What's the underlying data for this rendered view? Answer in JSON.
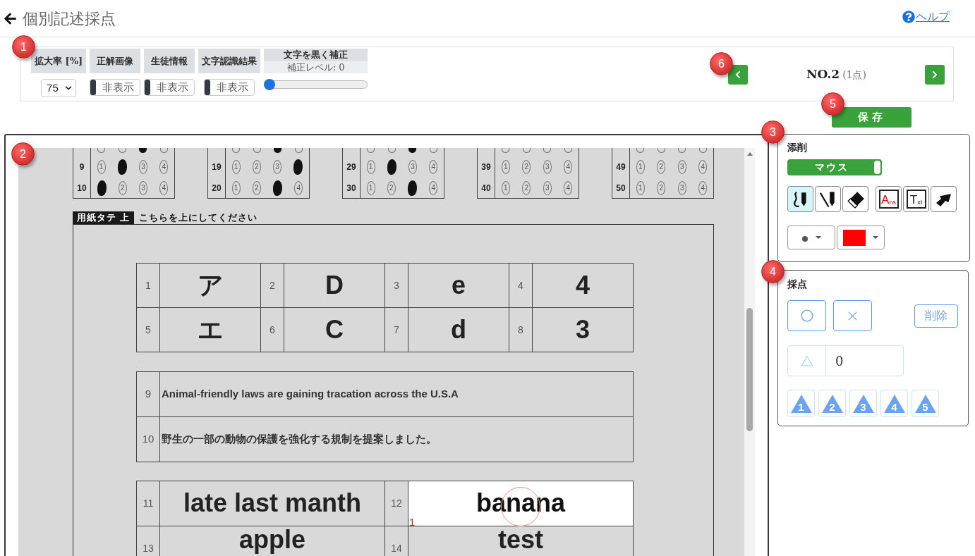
{
  "header": {
    "title": "個別記述採点",
    "help_link": "ヘルプ"
  },
  "toolbar": {
    "controls": [
      {
        "kind": "select",
        "label": "拡大率 [%]",
        "value": "75"
      },
      {
        "kind": "toggle",
        "label": "正解画像",
        "value": "非表示",
        "on": false
      },
      {
        "kind": "toggle",
        "label": "生徒情報",
        "value": "非表示",
        "on": false
      },
      {
        "kind": "toggle",
        "label": "文字認識結果",
        "value": "非表示",
        "on": false
      },
      {
        "kind": "slider",
        "label": "文字を黒く補正",
        "reading": "補正レベル: 0",
        "level": 0
      }
    ],
    "navigation": {
      "number": "NO.2",
      "points": "(1点)"
    }
  },
  "save_button": "保存",
  "answer_sheet": {
    "bubble_blocks": [
      {
        "rows": [
          {
            "bubbles": [
              {
                "filled": false
              },
              {
                "filled": false
              },
              {
                "filled": true
              },
              {
                "filled": false
              }
            ]
          },
          {
            "number": "9",
            "bubbles": [
              {
                "label": "1",
                "filled": false
              },
              {
                "filled": true
              },
              {
                "label": "3",
                "filled": false
              },
              {
                "label": "4",
                "filled": false
              }
            ]
          },
          {
            "number": "10",
            "bubbles": [
              {
                "filled": true
              },
              {
                "label": "2",
                "filled": false
              },
              {
                "label": "3",
                "filled": false
              },
              {
                "label": "4",
                "filled": false
              }
            ]
          }
        ]
      },
      {
        "rows": [
          {
            "bubbles": [
              {
                "filled": false
              },
              {
                "filled": false
              },
              {
                "filled": true
              },
              {
                "filled": false
              }
            ]
          },
          {
            "number": "19",
            "bubbles": [
              {
                "label": "1",
                "filled": false
              },
              {
                "label": "2",
                "filled": false
              },
              {
                "label": "3",
                "filled": false
              },
              {
                "filled": true
              }
            ]
          },
          {
            "number": "20",
            "bubbles": [
              {
                "label": "1",
                "filled": false
              },
              {
                "label": "2",
                "filled": false
              },
              {
                "filled": true
              },
              {
                "label": "4",
                "filled": false
              }
            ]
          }
        ]
      },
      {
        "rows": [
          {
            "bubbles": [
              {
                "filled": false
              },
              {
                "filled": false
              },
              {
                "filled": true
              },
              {
                "filled": false
              }
            ]
          },
          {
            "number": "29",
            "bubbles": [
              {
                "label": "1",
                "filled": false
              },
              {
                "filled": true
              },
              {
                "label": "3",
                "filled": false
              },
              {
                "label": "4",
                "filled": false
              }
            ]
          },
          {
            "number": "30",
            "bubbles": [
              {
                "label": "1",
                "filled": false
              },
              {
                "label": "2",
                "filled": false
              },
              {
                "filled": true
              },
              {
                "label": "4",
                "filled": false
              }
            ]
          }
        ]
      },
      {
        "rows": [
          {
            "bubbles": [
              {
                "filled": false
              },
              {
                "filled": false
              },
              {
                "filled": false
              },
              {
                "filled": false
              }
            ]
          },
          {
            "number": "39",
            "bubbles": [
              {
                "label": "1",
                "filled": false
              },
              {
                "label": "2",
                "filled": false
              },
              {
                "label": "3",
                "filled": false
              },
              {
                "label": "4",
                "filled": false
              }
            ]
          },
          {
            "number": "40",
            "bubbles": [
              {
                "label": "1",
                "filled": false
              },
              {
                "label": "2",
                "filled": false
              },
              {
                "label": "3",
                "filled": false
              },
              {
                "label": "4",
                "filled": false
              }
            ]
          }
        ]
      },
      {
        "rows": [
          {
            "bubbles": [
              {
                "filled": false
              },
              {
                "filled": false
              },
              {
                "filled": false
              },
              {
                "filled": false
              }
            ]
          },
          {
            "number": "49",
            "bubbles": [
              {
                "label": "1",
                "filled": false
              },
              {
                "label": "2",
                "filled": false
              },
              {
                "label": "3",
                "filled": false
              },
              {
                "label": "4",
                "filled": false
              }
            ]
          },
          {
            "number": "50",
            "bubbles": [
              {
                "label": "1",
                "filled": false
              },
              {
                "label": "2",
                "filled": false
              },
              {
                "label": "3",
                "filled": false
              },
              {
                "label": "4",
                "filled": false
              }
            ]
          }
        ]
      }
    ],
    "orientation_tag": "用紙タテ 上",
    "orientation_note": "こちらを上にしてください",
    "choice_table": [
      [
        {
          "number": "1",
          "answer": "ア"
        },
        {
          "number": "2",
          "answer": "D"
        },
        {
          "number": "3",
          "answer": "e"
        },
        {
          "number": "4",
          "answer": "4"
        }
      ],
      [
        {
          "number": "5",
          "answer": "エ"
        },
        {
          "number": "6",
          "answer": "C"
        },
        {
          "number": "7",
          "answer": "d"
        },
        {
          "number": "8",
          "answer": "3"
        }
      ]
    ],
    "sentence_table": [
      {
        "number": "9",
        "answer": "Animal-friendly laws are gaining tracation across the U.S.A"
      },
      {
        "number": "10",
        "answer": "野生の一部の動物の保護を強化する規制を提案しました。"
      }
    ],
    "word_table": [
      [
        {
          "number": "11",
          "answer": "late last manth",
          "selected": false,
          "circled": false
        },
        {
          "number": "12",
          "answer": "banana",
          "selected": true,
          "circled": true,
          "score_mark": "1"
        }
      ],
      [
        {
          "number": "13",
          "answer": "apple",
          "selected": false,
          "circled": false
        },
        {
          "number": "14",
          "answer": "test",
          "selected": false,
          "circled": false
        }
      ]
    ]
  },
  "edit_panel": {
    "title": "添削",
    "mode_switch": {
      "label": "マウス",
      "on": true
    },
    "tool_groups": [
      [
        {
          "kind": "freehand",
          "selected": true
        },
        {
          "kind": "line",
          "selected": false
        },
        {
          "kind": "eraser",
          "selected": false
        }
      ],
      [
        {
          "kind": "answer_text",
          "selected": false,
          "text": "A",
          "subscript": "ns"
        },
        {
          "kind": "text",
          "selected": false,
          "text": "T",
          "subscript": "xt"
        },
        {
          "kind": "pointer",
          "selected": false
        }
      ]
    ],
    "color_dropdown": {
      "color": "#ff0000"
    }
  },
  "scoring_panel": {
    "title": "採点",
    "delete_button": "削除",
    "partial_score": {
      "value": "0"
    },
    "partial_buttons": [
      "1",
      "2",
      "3",
      "4",
      "5"
    ]
  },
  "callouts": [
    "1",
    "2",
    "3",
    "4",
    "5",
    "6"
  ]
}
